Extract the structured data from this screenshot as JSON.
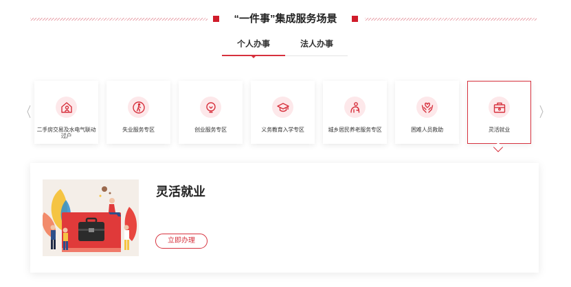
{
  "header": {
    "title": "“一件事”集成服务场景"
  },
  "tabs": [
    {
      "label": "个人办事",
      "active": true
    },
    {
      "label": "法人办事",
      "active": false
    }
  ],
  "carousel": {
    "prev_icon": "chevron-left-icon",
    "next_icon": "chevron-right-icon",
    "items": [
      {
        "label": "二手房交易及水电气联动过户",
        "icon": "house-person-icon"
      },
      {
        "label": "失业服务专区",
        "icon": "walking-person-icon"
      },
      {
        "label": "创业服务专区",
        "icon": "lightbulb-icon"
      },
      {
        "label": "义务教育入学专区",
        "icon": "graduation-cap-icon"
      },
      {
        "label": "城乡居民养老服务专区",
        "icon": "elderly-person-icon"
      },
      {
        "label": "困难人员救助",
        "icon": "hands-heart-icon"
      },
      {
        "label": "灵活就业",
        "icon": "briefcase-icon",
        "active": true
      }
    ]
  },
  "detail": {
    "title": "灵活就业",
    "button_label": "立即办理",
    "image": "flexible-employment-illustration"
  },
  "colors": {
    "accent": "#d6303c",
    "accent_dark": "#d01c2b",
    "icon_bg": "#fde8ea",
    "illustration_bg": "#f4eee8"
  }
}
